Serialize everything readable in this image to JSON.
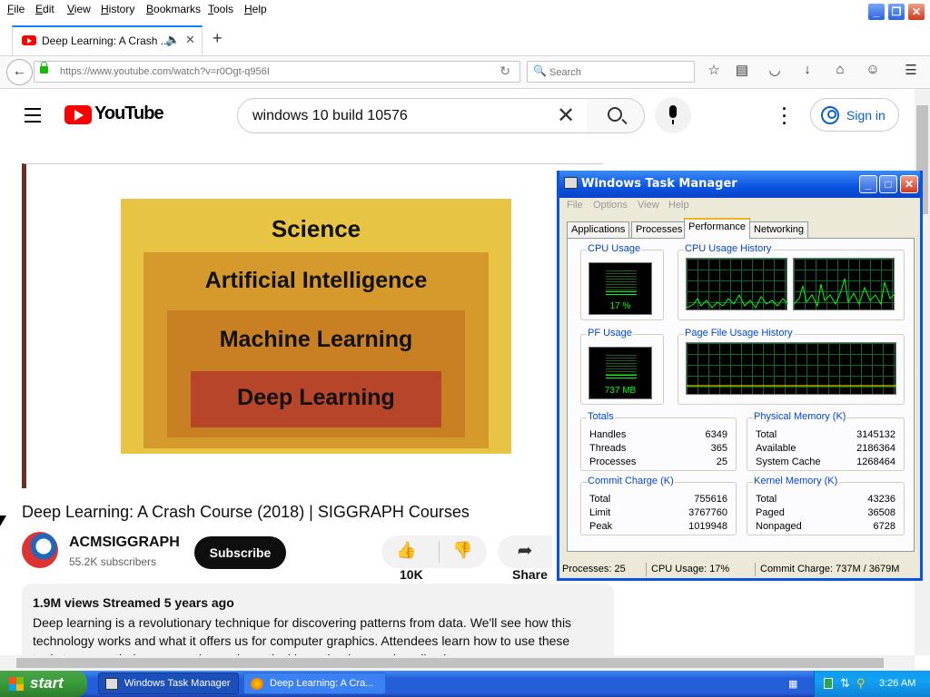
{
  "firefox": {
    "menu": [
      "File",
      "Edit",
      "View",
      "History",
      "Bookmarks",
      "Tools",
      "Help"
    ],
    "tab_title": "Deep Learning: A Crash ...",
    "url": "https://www.youtube.com/watch?v=r0Ogt-q956I",
    "search_placeholder": "Search"
  },
  "youtube": {
    "logo_text": "YouTube",
    "search_query": "windows 10 build 10576",
    "sign_in": "Sign in",
    "slide": {
      "level1": "Science",
      "level2": "Artificial Intelligence",
      "level3": "Machine Learning",
      "level4": "Deep Learning"
    },
    "video_title": "Deep Learning: A Crash Course (2018) | SIGGRAPH Courses",
    "channel_name": "ACMSIGGRAPH",
    "subscribers": "55.2K subscribers",
    "subscribe_label": "Subscribe",
    "like_count": "10K",
    "share_label": "Share",
    "desc_stats": "1.9M views  Streamed 5 years ago",
    "desc_text": "Deep learning is a revolutionary technique for discovering patterns from data. We'll see how this technology works and what it offers us for computer graphics. Attendees learn how to use these tools to power their own creative and practical investigations and applications."
  },
  "task_manager": {
    "title": "Windows Task Manager",
    "menu": [
      "File",
      "Options",
      "View",
      "Help"
    ],
    "tabs": [
      "Applications",
      "Processes",
      "Performance",
      "Networking"
    ],
    "active_tab": "Performance",
    "cpu_usage_label": "CPU Usage",
    "cpu_usage_value": "17 %",
    "cpu_usage_fraction": 0.17,
    "cpu_history_label": "CPU Usage History",
    "pf_usage_label": "PF Usage",
    "pf_usage_value": "737 MB",
    "pf_usage_fraction": 0.2,
    "pf_history_label": "Page File Usage History",
    "totals": {
      "label": "Totals",
      "rows": [
        [
          "Handles",
          "6349"
        ],
        [
          "Threads",
          "365"
        ],
        [
          "Processes",
          "25"
        ]
      ]
    },
    "physical": {
      "label": "Physical Memory (K)",
      "rows": [
        [
          "Total",
          "3145132"
        ],
        [
          "Available",
          "2186364"
        ],
        [
          "System Cache",
          "1268464"
        ]
      ]
    },
    "commit": {
      "label": "Commit Charge (K)",
      "rows": [
        [
          "Total",
          "755616"
        ],
        [
          "Limit",
          "3767760"
        ],
        [
          "Peak",
          "1019948"
        ]
      ]
    },
    "kernel": {
      "label": "Kernel Memory (K)",
      "rows": [
        [
          "Total",
          "43236"
        ],
        [
          "Paged",
          "36508"
        ],
        [
          "Nonpaged",
          "6728"
        ]
      ]
    },
    "status": {
      "processes": "Processes: 25",
      "cpu": "CPU Usage: 17%",
      "commit": "Commit Charge: 737M / 3679M"
    }
  },
  "taskbar": {
    "start": "start",
    "items": [
      "Windows Task Manager",
      "Deep Learning: A Cra..."
    ],
    "clock": "3:26 AM"
  },
  "colors": {
    "accent": "#0b54e3",
    "youtube_red": "#ff0000",
    "graph_green": "#00ff00"
  }
}
